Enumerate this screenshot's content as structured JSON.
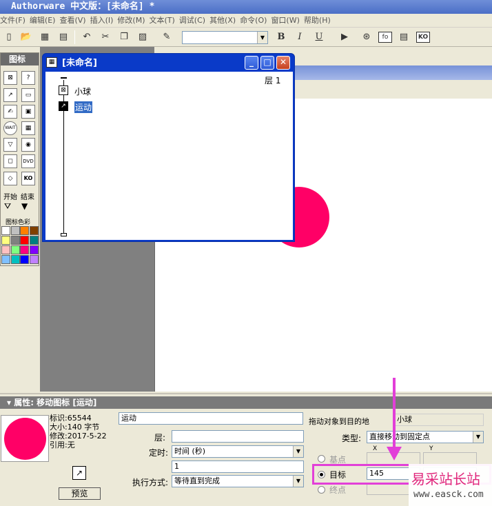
{
  "window": {
    "title": "Authorware 中文版：[未命名] *"
  },
  "menu": [
    "文件(F)",
    "编辑(E)",
    "查看(V)",
    "插入(I)",
    "修改(M)",
    "文本(T)",
    "调试(C)",
    "其他(X)",
    "命令(O)",
    "窗口(W)",
    "帮助(H)"
  ],
  "toolbar": {
    "bold": "B",
    "italic": "I",
    "underline": "U",
    "fo_label": "fo",
    "ko_label": "KO"
  },
  "palette": {
    "title": "图标",
    "start_label": "开始",
    "end_label": "结束",
    "colors_label": "图标色彩",
    "wait_label": "WAIT",
    "dvd_label": "DVD",
    "ko_label": "KO",
    "colors": [
      "#ffffff",
      "#c0c0c0",
      "#ff8000",
      "#804000",
      "#ffff80",
      "#808080",
      "#ff0000",
      "#008080",
      "#ffc0c0",
      "#80ff80",
      "#ff0080",
      "#8000ff",
      "#80c0ff",
      "#00c0c0",
      "#0000ff",
      "#c080ff"
    ]
  },
  "design_window": {
    "title": "[未命名]",
    "layer": "层 1",
    "icons": [
      {
        "label": "小球",
        "selected": false
      },
      {
        "label": "运动",
        "selected": true
      }
    ]
  },
  "properties": {
    "title": "属性: 移动图标 [运动]",
    "info": {
      "id": "标识:65544",
      "size": "大小:140 字节",
      "modified": "修改:2017-5-22",
      "ref": "引用:无"
    },
    "preview_button": "预览",
    "name_value": "运动",
    "layer_label": "层:",
    "layer_value": "",
    "timing_label": "定时:",
    "timing_value": "时间 (秒)",
    "timing_number": "1",
    "exec_label": "执行方式:",
    "exec_value": "等待直到完成",
    "drag_label": "拖动对象到目的地",
    "drag_object": "小球",
    "type_label": "类型:",
    "type_value": "直接移动到固定点",
    "x_header": "X",
    "y_header": "Y",
    "base_label": "基点",
    "target_label": "目标",
    "end_label": "终点",
    "target_x": "145",
    "target_y": ""
  },
  "watermark": {
    "line1": "易采站长站",
    "line2": "www.easck.com"
  },
  "colors": {
    "ball": "#ff0066",
    "annotation": "#e23fd8",
    "titlebar": "#0a3ac8"
  }
}
